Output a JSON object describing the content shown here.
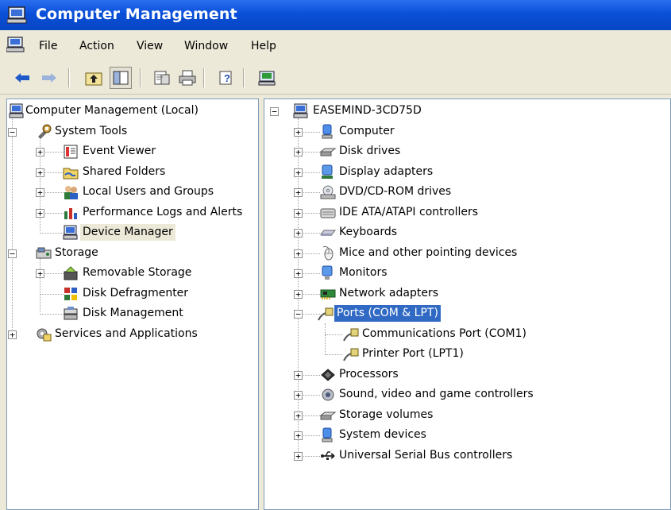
{
  "window": {
    "title": "Computer Management",
    "accent": "#0a4fd8",
    "selection_color": "#316ac5"
  },
  "menu": {
    "items": [
      "File",
      "Action",
      "View",
      "Window",
      "Help"
    ]
  },
  "toolbar": {
    "icons": [
      "back-arrow-icon",
      "forward-arrow-icon",
      "up-folder-icon",
      "show-hide-tree-icon",
      "properties-icon",
      "print-icon",
      "help-icon",
      "device-manager-icon"
    ]
  },
  "left_tree": {
    "root": "Computer Management (Local)",
    "system_tools": "System Tools",
    "event_viewer": "Event Viewer",
    "shared_folders": "Shared Folders",
    "local_users": "Local Users and Groups",
    "perf_logs": "Performance Logs and Alerts",
    "device_manager": "Device Manager",
    "storage": "Storage",
    "removable_storage": "Removable Storage",
    "disk_defrag": "Disk Defragmenter",
    "disk_mgmt": "Disk Management",
    "services_apps": "Services and Applications"
  },
  "right_tree": {
    "root": "EASEMIND-3CD75D",
    "items": [
      "Computer",
      "Disk drives",
      "Display adapters",
      "DVD/CD-ROM drives",
      "IDE ATA/ATAPI controllers",
      "Keyboards",
      "Mice and other pointing devices",
      "Monitors",
      "Network adapters",
      "Ports (COM & LPT)",
      "Communications Port (COM1)",
      "Printer Port (LPT1)",
      "Processors",
      "Sound, video and game controllers",
      "Storage volumes",
      "System devices",
      "Universal Serial Bus controllers"
    ]
  }
}
